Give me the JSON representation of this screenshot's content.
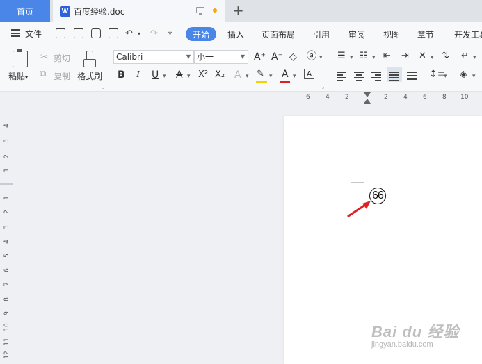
{
  "tabs": {
    "home": "首页",
    "document": "百度经验.doc",
    "new_tab_symbol": "+"
  },
  "menu": {
    "file": "文件",
    "items": [
      "开始",
      "插入",
      "页面布局",
      "引用",
      "审阅",
      "视图",
      "章节",
      "开发工具"
    ]
  },
  "ribbon": {
    "paste": "粘贴",
    "cut": "剪切",
    "copy": "复制",
    "format_painter": "格式刷",
    "font_name": "Calibri",
    "font_size": "小一",
    "bold": "B",
    "italic": "I",
    "underline": "U",
    "strike": "A",
    "superscript": "X²",
    "subscript": "X₂",
    "text_effect": "A",
    "font_color": "A",
    "char_border": "A",
    "grow_font": "A⁺",
    "shrink_font": "A⁻",
    "phonetic": "ⓐ"
  },
  "ruler": {
    "top_numbers": [
      "6",
      "4",
      "2",
      "2",
      "4",
      "6",
      "8",
      "10"
    ],
    "left_numbers_upper": [
      "4",
      "3",
      "2",
      "1"
    ],
    "left_numbers_lower": [
      "1",
      "2",
      "3",
      "4",
      "5",
      "6",
      "7",
      "8",
      "9",
      "10",
      "11",
      "12"
    ]
  },
  "document": {
    "enclosed_text": "66"
  },
  "watermark": {
    "logo": "Bai du 经验",
    "url": "jingyan.baidu.com"
  },
  "colors": {
    "accent": "#4a86e8",
    "unsaved_dot": "#f2a516",
    "arrow": "#e02020",
    "highlight": "#f5d000",
    "font_color_bar": "#e02020"
  }
}
